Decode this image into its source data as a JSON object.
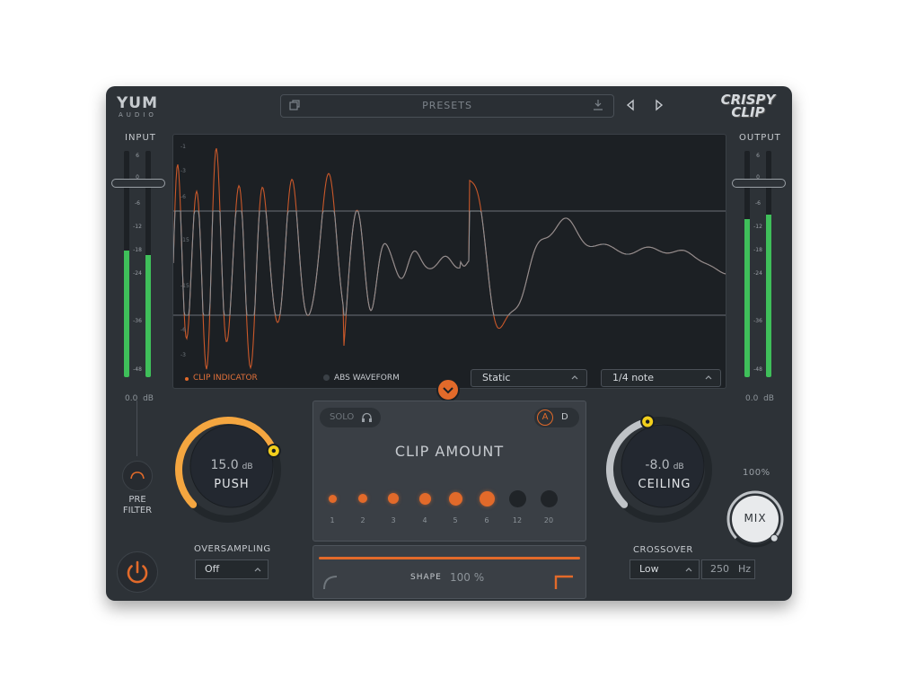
{
  "header": {
    "logo_main": "YUM",
    "logo_sub": "AUDIO",
    "presets_label": "PRESETS",
    "brand_line1": "CRISPY",
    "brand_line2": "CLIP"
  },
  "input_meter": {
    "title": "INPUT",
    "ticks": [
      "6",
      "0",
      "-6",
      "-12",
      "-18",
      "-24",
      "-36",
      "-48"
    ],
    "readout_value": "0.0",
    "readout_unit": "dB",
    "level_left": 0.56,
    "level_right": 0.54
  },
  "output_meter": {
    "title": "OUTPUT",
    "ticks": [
      "6",
      "0",
      "-6",
      "-12",
      "-18",
      "-24",
      "-36",
      "-48"
    ],
    "readout_value": "0.0",
    "readout_unit": "dB",
    "level_left": 0.7,
    "level_right": 0.72
  },
  "display": {
    "scale_labels": [
      "-1",
      "-3",
      "-6",
      "-15",
      "-15",
      "-6",
      "-3"
    ],
    "clip_indicator": "CLIP INDICATOR",
    "abs_waveform": "ABS WAVEFORM",
    "mode_value": "Static",
    "rate_value": "1/4 note"
  },
  "clip_panel": {
    "solo_label": "SOLO",
    "a_label": "A",
    "d_label": "D",
    "title": "CLIP AMOUNT",
    "amounts": [
      {
        "label": "1",
        "active": true
      },
      {
        "label": "2",
        "active": true
      },
      {
        "label": "3",
        "active": true
      },
      {
        "label": "4",
        "active": true
      },
      {
        "label": "5",
        "active": true
      },
      {
        "label": "6",
        "active": true
      },
      {
        "label": "12",
        "active": false
      },
      {
        "label": "20",
        "active": false
      }
    ]
  },
  "shape": {
    "label": "SHAPE",
    "value": "100 %",
    "amount": 1.0
  },
  "push": {
    "value": "15.0",
    "unit": "dB",
    "label": "PUSH",
    "amount": 0.75
  },
  "ceiling": {
    "value": "-8.0",
    "unit": "dB",
    "label": "CEILING",
    "amount": 0.45
  },
  "mix": {
    "label": "MIX",
    "value": "100%",
    "amount": 1.0
  },
  "pre_filter": {
    "line1": "PRE",
    "line2": "FILTER"
  },
  "oversampling": {
    "label": "OVERSAMPLING",
    "value": "Off"
  },
  "crossover": {
    "label": "CROSSOVER",
    "band": "Low",
    "freq_value": "250",
    "freq_unit": "Hz"
  },
  "colors": {
    "accent": "#e26a2a",
    "meter": "#3fbf5a",
    "knob_yellow": "#f2cf1c",
    "panel": "#2d3237"
  },
  "icons": [
    "copy-icon",
    "download-icon",
    "prev-arrow-icon",
    "next-arrow-icon",
    "headphones-icon",
    "chevron-down-icon",
    "power-icon",
    "filter-curve-icon",
    "chevron-up-icon"
  ]
}
